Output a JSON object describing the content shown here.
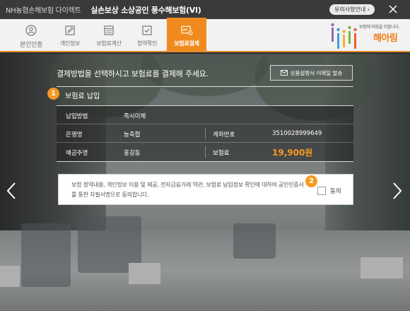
{
  "window": {
    "brand": "NH농협손해보험 다이렉트",
    "title": "실손보상 소상공인 풍수해보험(VI)",
    "notice_label": "유의사항안내 ›"
  },
  "steps": [
    {
      "label": "본인인증",
      "icon": "person-icon"
    },
    {
      "label": "개인정보",
      "icon": "edit-icon"
    },
    {
      "label": "보험료계산",
      "icon": "calculator-icon"
    },
    {
      "label": "청약확인",
      "icon": "checkbox-icon"
    },
    {
      "label": "보험료결제",
      "icon": "card-payment-icon",
      "active": true
    }
  ],
  "logo": {
    "tagline": "보험에 마음을 더합니다.",
    "name": "해아림",
    "colors": [
      "#8e6bb8",
      "#3da0d8",
      "#f6b23a",
      "#7cb342",
      "#e8632b"
    ]
  },
  "main": {
    "instruction": "결제방법을 선택하시고 보험료를 결제해 주세요.",
    "email_button": "상품설명서 이메일 발송",
    "section": {
      "number": "1",
      "title": "보험료 납입"
    },
    "payment": {
      "method_label": "납입방법",
      "method_value": "즉시이체",
      "bank_label": "은행명",
      "bank_value": "농축협",
      "account_label": "계좌번호",
      "account_value": "3510028999649",
      "holder_label": "예금주명",
      "holder_value": "홍길동",
      "premium_label": "보험료",
      "premium_value": "19,900원"
    },
    "agreement": {
      "number": "2",
      "text": "보험 청약내용, 개인정보 이용 및 제공, 전자금융거래 약관, 보험료 납입정보 확인에 대하여 공인인증서를 통한 자필서명으로 동의합니다.",
      "checkbox_label": "동의"
    }
  },
  "colors": {
    "accent": "#f08a1e",
    "premium": "#f59a23",
    "titlebar": "#3a3a3a"
  }
}
